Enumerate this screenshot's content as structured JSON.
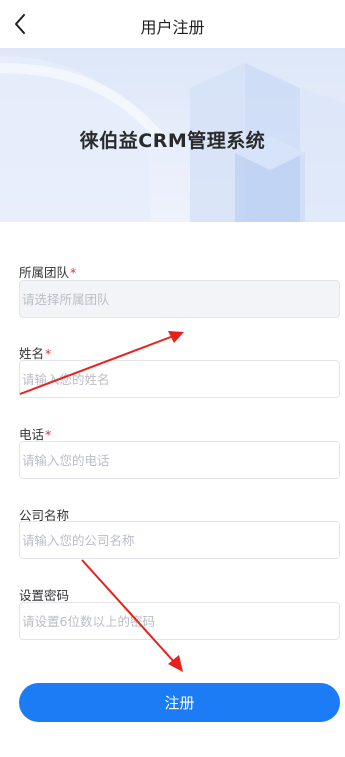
{
  "nav": {
    "title": "用户注册"
  },
  "banner": {
    "system_name": "徕伯益CRM管理系统"
  },
  "form": {
    "fields": [
      {
        "label": "所属团队",
        "required": true,
        "placeholder": "请选择所属团队",
        "disabled": true
      },
      {
        "label": "姓名",
        "required": true,
        "placeholder": "请输入您的姓名",
        "disabled": false
      },
      {
        "label": "电话",
        "required": true,
        "placeholder": "请输入您的电话",
        "disabled": false
      },
      {
        "label": "公司名称",
        "required": false,
        "placeholder": "请输入您的公司名称",
        "disabled": false
      },
      {
        "label": "设置密码",
        "required": false,
        "placeholder": "请设置6位数以上的密码",
        "disabled": false
      }
    ],
    "required_mark": "*",
    "submit_label": "注册"
  },
  "colors": {
    "accent": "#1b7cf5",
    "required": "#e0303a",
    "annotation_arrow": "#e8201c",
    "banner_bg": "#dde7f8"
  }
}
